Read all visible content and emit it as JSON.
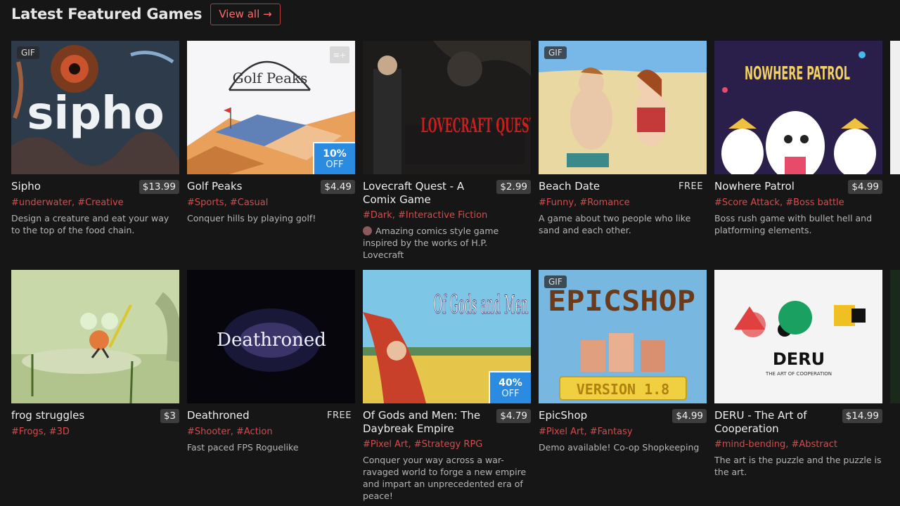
{
  "header": {
    "title": "Latest Featured Games",
    "view_all": "View all →"
  },
  "games_row1": [
    {
      "title": "Sipho",
      "price": "$13.99",
      "tags": [
        "#underwater",
        "#Creative"
      ],
      "desc": "Design a creature and eat your way to the top of the food chain.",
      "gif": "GIF",
      "thumb_title": "sipho"
    },
    {
      "title": "Golf Peaks",
      "price": "$4.49",
      "tags": [
        "#Sports",
        "#Casual"
      ],
      "desc": "Conquer hills by playing golf!",
      "sale_pct": "10%",
      "sale_off": "OFF",
      "thumb_title": "Golf Peaks"
    },
    {
      "title": "Lovecraft Quest - A Comix Game",
      "price": "$2.99",
      "tags": [
        "#Dark",
        "#Interactive Fiction"
      ],
      "desc": "Amazing comics style game inspired by the works of H.P. Lovecraft",
      "thumb_title": "LOVECRAFT QUEST"
    },
    {
      "title": "Beach Date",
      "price": "FREE",
      "tags": [
        "#Funny",
        "#Romance"
      ],
      "desc": "A game about two people who like sand and each other.",
      "gif": "GIF"
    },
    {
      "title": "Nowhere Patrol",
      "price": "$4.99",
      "tags": [
        "#Score Attack",
        "#Boss battle"
      ],
      "desc": "Boss rush game with bullet hell and platforming elements.",
      "thumb_title": "NOWHERE PATROL"
    }
  ],
  "games_row2": [
    {
      "title": "frog struggles",
      "price": "$3",
      "tags": [
        "#Frogs",
        "#3D"
      ],
      "desc": ""
    },
    {
      "title": "Deathroned",
      "price": "FREE",
      "tags": [
        "#Shooter",
        "#Action"
      ],
      "desc": "Fast paced FPS Roguelike",
      "thumb_title": "Deathroned"
    },
    {
      "title": "Of Gods and Men: The Daybreak Empire",
      "price": "$4.79",
      "tags": [
        "#Pixel Art",
        "#Strategy RPG"
      ],
      "desc": "Conquer your way across a war-ravaged world to forge a new empire and impart an unprecedented era of peace!",
      "sale_pct": "40%",
      "sale_off": "OFF",
      "thumb_title": "Of Gods and Men"
    },
    {
      "title": "EpicShop",
      "price": "$4.99",
      "tags": [
        "#Pixel Art",
        "#Fantasy"
      ],
      "desc": "Demo available! Co-op Shopkeeping",
      "gif": "GIF",
      "thumb_title": "EPICSHOP",
      "thumb_sub": "VERSION 1.8"
    },
    {
      "title": "DERU - The Art of Cooperation",
      "price": "$14.99",
      "tags": [
        "#mind-bending",
        "#Abstract"
      ],
      "desc": "The art is the puzzle and the puzzle is the art.",
      "thumb_title": "DERU",
      "thumb_sub": "THE ART OF COOPERATION"
    }
  ],
  "colors": {
    "accent": "#ff6b6b",
    "tag": "#d94a4a",
    "sale": "#2a8be0",
    "bg": "#161616"
  }
}
